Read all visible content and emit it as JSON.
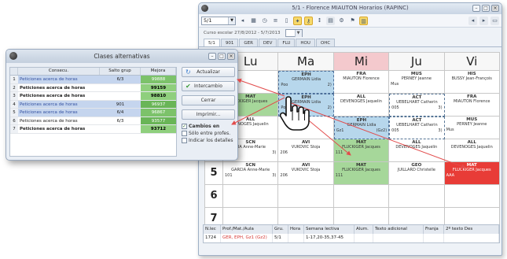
{
  "main_window": {
    "title": "5/1 - Florence MIAUTON Horarios (RAPINC)",
    "class_select": "5/1",
    "school_year": "Curso escolar 27/8/2012 - 5/7/2013",
    "tabs": [
      "5/1",
      "901",
      "GER",
      "DEV",
      "FLU",
      "HOU",
      "OHC"
    ]
  },
  "timetable": {
    "days": [
      "Lu",
      "Ma",
      "Mi",
      "Ju",
      "Vi"
    ],
    "periods": [
      "1",
      "2",
      "3",
      "4",
      "5",
      "6",
      "7"
    ],
    "rows": [
      [
        {
          "subj": "",
          "teacher": "",
          "room": "",
          "n": ""
        },
        {
          "subj": "EPH",
          "teacher": "GERMAIN Lidia",
          "room": "Poo",
          "n": "2)"
        },
        {
          "subj": "FRA",
          "teacher": "MIAUTON Florence",
          "room": "",
          "n": ""
        },
        {
          "subj": "MUS",
          "teacher": "PERNEY Jeanne",
          "room": "Mus",
          "n": ""
        },
        {
          "subj": "HIS",
          "teacher": "BUSSY Jean-François",
          "room": "",
          "n": ""
        }
      ],
      [
        {
          "subj": "MAT",
          "teacher": "UCKIGER Jacques",
          "room": "",
          "n": ""
        },
        {
          "subj": "EPH",
          "teacher": "GERMAIN Lidia",
          "room": "Poo",
          "n": "2)"
        },
        {
          "subj": "ALL",
          "teacher": "DEVENOGES Jaquelin",
          "room": "",
          "n": ""
        },
        {
          "subj": "ACT",
          "teacher": "UEBELHART Catherin",
          "room": "005",
          "n": "3)"
        },
        {
          "subj": "FRA",
          "teacher": "MIAUTON Florence",
          "room": "",
          "n": ""
        }
      ],
      [
        {
          "subj": "ALL",
          "teacher": "VENOGES Jaquelin",
          "room": "",
          "n": ""
        },
        {
          "subj": "",
          "teacher": "",
          "room": "",
          "n": ""
        },
        {
          "subj": "EPH",
          "teacher": "GERMAIN Lidia",
          "room": "Gz1",
          "n": "(Gz2)"
        },
        {
          "subj": "ACT",
          "teacher": "UEBELHART Catherin",
          "room": "005",
          "n": "3)"
        },
        {
          "subj": "MUS",
          "teacher": "PERNEY Jeanne",
          "room": "Mus",
          "n": ""
        }
      ],
      [
        {
          "subj": "SCN",
          "teacher": "CIA Anne-Marie",
          "room": "",
          "n": "3)"
        },
        {
          "subj": "AVI",
          "teacher": "VUKOVIC Stoja",
          "room": "206",
          "n": ""
        },
        {
          "subj": "MAT",
          "teacher": "FLUCKIGER Jacques",
          "room": "111",
          "n": ""
        },
        {
          "subj": "ALL",
          "teacher": "DEVENOGES Jaquelin",
          "room": "",
          "n": ""
        },
        {
          "subj": "ALL",
          "teacher": "DEVENOGES Jaquelin",
          "room": "",
          "n": ""
        }
      ],
      [
        {
          "subj": "SCN",
          "teacher": "GARCIA Anne-Marie",
          "room": "101",
          "n": "3)"
        },
        {
          "subj": "AVI",
          "teacher": "VUKOVIC Stoja",
          "room": "206",
          "n": ""
        },
        {
          "subj": "MAT",
          "teacher": "FLUCKIGER Jacques",
          "room": "111",
          "n": ""
        },
        {
          "subj": "GEO",
          "teacher": "JUILLARD Christelle",
          "room": "",
          "n": ""
        },
        {
          "subj": "MAT",
          "teacher": "FLUCKIGER Jacques",
          "room": "AAA",
          "n": ""
        }
      ]
    ]
  },
  "detail_table": {
    "headers": [
      "N.lec",
      "Prof./Mat./Aula",
      "Gru.",
      "Hora",
      "Semana lectiva",
      "Alum.",
      "Texto adicional",
      "Franja",
      "2º texto Des"
    ],
    "row": [
      "1724",
      "GER, EPH, Gz1 (Gz2)",
      "5/1",
      "",
      "1-17,20-35,37-45",
      "",
      "",
      "",
      ""
    ]
  },
  "dialog": {
    "title": "Clases alternativas",
    "headers": [
      "Consecu.",
      "Salto grup",
      "Mejora"
    ],
    "rows": [
      {
        "n": "1",
        "name": "Peticiones acerca de horas",
        "salto": "6/3",
        "mejora": "99888"
      },
      {
        "n": "2",
        "name": "Peticiones acerca de horas",
        "salto": "",
        "mejora": "99159"
      },
      {
        "n": "3",
        "name": "Peticiones acerca de horas",
        "salto": "",
        "mejora": "98810"
      },
      {
        "n": "4",
        "name": "Peticiones acerca de horas",
        "salto": "901",
        "mejora": "96937"
      },
      {
        "n": "5",
        "name": "Peticiones acerca de horas",
        "salto": "6/4",
        "mejora": "96867"
      },
      {
        "n": "6",
        "name": "Peticiones acerca de horas",
        "salto": "6/3",
        "mejora": "93577"
      },
      {
        "n": "7",
        "name": "Peticiones acerca de horas",
        "salto": "",
        "mejora": "93712"
      }
    ],
    "buttons": {
      "refresh": "Actualizar",
      "swap": "Intercambio",
      "close": "Cerrar",
      "print": "Imprimir..."
    },
    "checkboxes": {
      "changes": "Cambios en",
      "teachers_only": "Sólo entre profes.",
      "show_details": "Indicar los detalles"
    }
  },
  "icons": [
    "refresh-icon",
    "check-icon",
    "hand-cursor-icon"
  ]
}
